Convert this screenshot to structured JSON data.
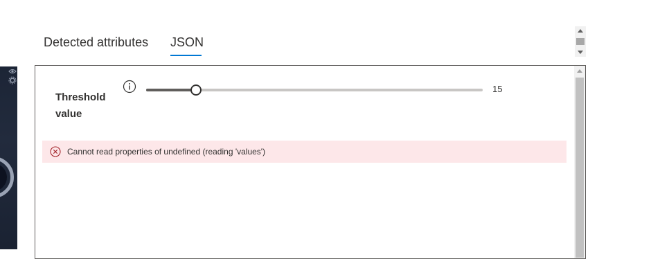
{
  "tabs": [
    {
      "label": "Detected attributes",
      "selected": false
    },
    {
      "label": "JSON",
      "selected": true
    }
  ],
  "accent_color": "#0078d4",
  "threshold": {
    "label": "Threshold value",
    "value": "15",
    "fraction": 0.148,
    "info_icon": "info-icon"
  },
  "error": {
    "message": "Cannot read properties of undefined (reading 'values')",
    "icon": "error-circle-x-icon",
    "background": "#fde7e9"
  }
}
